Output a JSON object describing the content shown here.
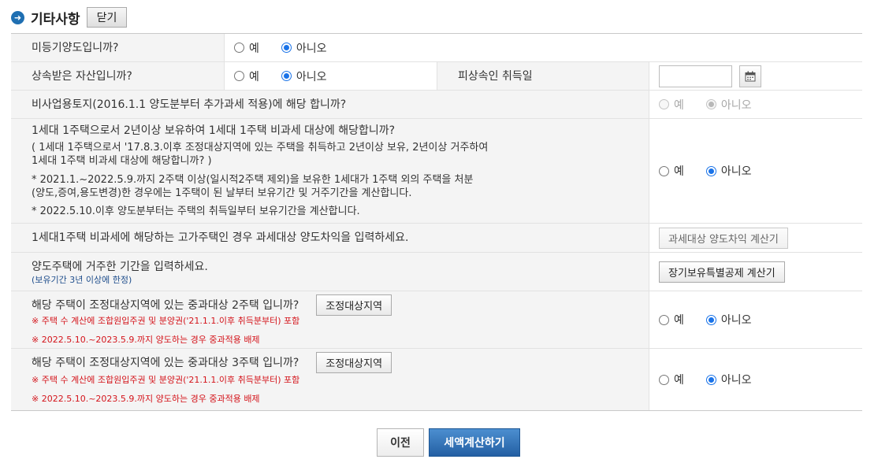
{
  "header": {
    "title": "기타사항",
    "close_label": "닫기"
  },
  "options": {
    "yes": "예",
    "no": "아니오"
  },
  "rows": {
    "unregistered": {
      "question": "미등기양도입니까?",
      "selected": "no"
    },
    "inherited": {
      "question": "상속받은 자산입니까?",
      "selected": "no",
      "acquisition_label": "피상속인 취득일",
      "acquisition_date": ""
    },
    "nonbusiness": {
      "question": "비사업용토지(2016.1.1 양도분부터 추가과세 적용)에 해당 합니까?",
      "selected": "no",
      "disabled": true
    },
    "one_house": {
      "question": "1세대 1주택으로서 2년이상 보유하여 1세대 1주택 비과세 대상에 해당합니까?",
      "note1_line1": "( 1세대 1주택으로서 '17.8.3.이후 조정대상지역에 있는 주택을 취득하고 2년이상 보유, 2년이상 거주하여",
      "note1_line2": "1세대 1주택 비과세 대상에 해당합니까? )",
      "note2_line1": "* 2021.1.~2022.5.9.까지 2주택 이상(일시적2주택 제외)을 보유한 1세대가 1주택 외의 주택을 처분",
      "note2_line2": "(양도,증여,용도변경)한 경우에는 1주택이 된 날부터 보유기간 및 거주기간을 계산합니다.",
      "note3": "* 2022.5.10.이후 양도분부터는 주택의 취득일부터 보유기간을 계산합니다.",
      "selected": "no"
    },
    "luxury": {
      "question": "1세대1주택 비과세에 해당하는 고가주택인 경우 과세대상 양도차익을 입력하세요.",
      "button_label": "과세대상 양도차익 계산기"
    },
    "residence": {
      "question": "양도주택에 거주한 기간을 입력하세요.",
      "note": "(보유기간 3년 이상에 한정)",
      "button_label": "장기보유특별공제 계산기"
    },
    "adjusted2": {
      "question": "해당 주택이 조정대상지역에 있는 중과대상 2주택 입니까?",
      "button_label": "조정대상지역",
      "note1": "※ 주택 수 계산에 조합원입주권 및 분양권('21.1.1.이후 취득분부터) 포함",
      "note2": "※ 2022.5.10.~2023.5.9.까지 양도하는 경우 중과적용 배제",
      "selected": "no"
    },
    "adjusted3": {
      "question": "해당 주택이 조정대상지역에 있는 중과대상 3주택 입니까?",
      "button_label": "조정대상지역",
      "note1": "※ 주택 수 계산에 조합원입주권 및 분양권('21.1.1.이후 취득분부터) 포함",
      "note2": "※ 2022.5.10.~2023.5.9.까지 양도하는 경우 중과적용 배제",
      "selected": "no"
    }
  },
  "footer": {
    "prev_label": "이전",
    "calc_label": "세액계산하기"
  },
  "colors": {
    "accent": "#1a73e8",
    "primary_button": "#2f6fb5",
    "note_red": "#d4141b",
    "note_blue": "#1f4e8c",
    "row_bg": "#f4f4f4"
  },
  "icons": {
    "section": "arrow-right-circle-icon",
    "date_picker": "calendar-icon"
  }
}
